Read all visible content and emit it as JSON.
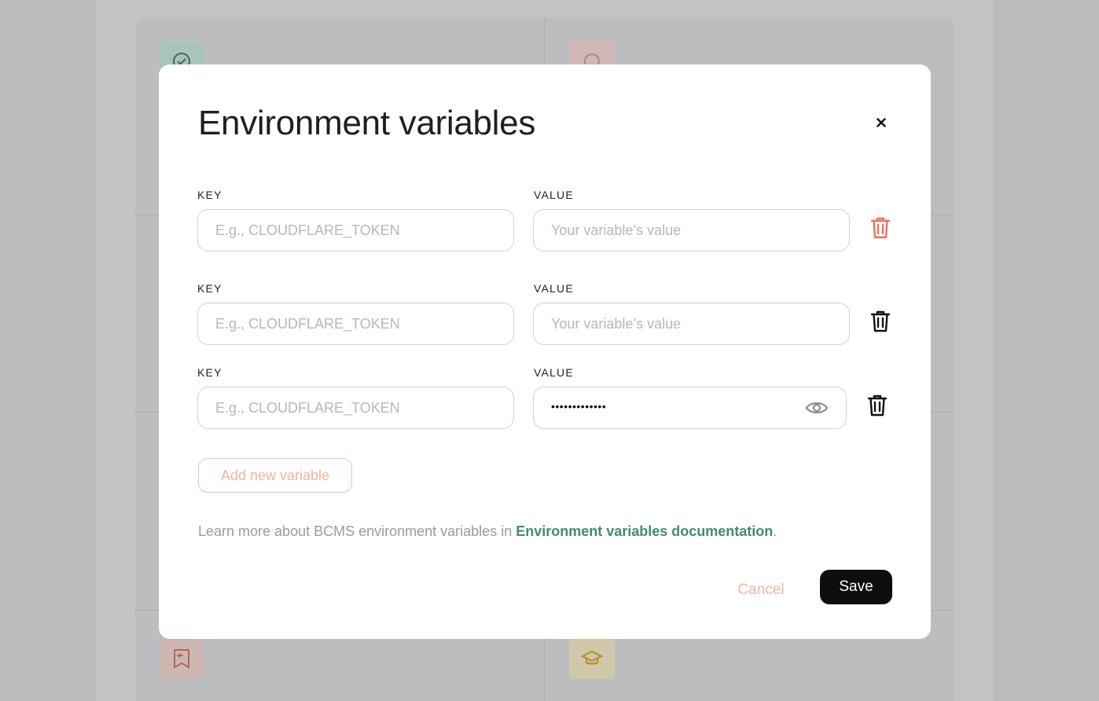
{
  "modal": {
    "title": "Environment variables",
    "rows": [
      {
        "key_label": "KEY",
        "key_value": "",
        "key_placeholder": "E.g., CLOUDFLARE_TOKEN",
        "value_label": "VALUE",
        "value_value": "",
        "value_placeholder": "Your variable’s value",
        "masked": false
      },
      {
        "key_label": "KEY",
        "key_value": "",
        "key_placeholder": "E.g., CLOUDFLARE_TOKEN",
        "value_label": "VALUE",
        "value_value": "",
        "value_placeholder": "Your variable’s value",
        "masked": false
      },
      {
        "key_label": "KEY",
        "key_value": "",
        "key_placeholder": "E.g., CLOUDFLARE_TOKEN",
        "value_label": "VALUE",
        "value_masked_text": "•••••••••••••",
        "masked": true
      }
    ],
    "add_button_label": "Add new variable",
    "learn_more_prefix": "Learn more about BCMS environment variables in ",
    "learn_more_link": "Environment variables documentation",
    "learn_more_suffix": ".",
    "cancel_label": "Cancel",
    "save_label": "Save"
  },
  "icons": {
    "close": "close-icon",
    "trash": "trash-icon",
    "eye": "eye-icon",
    "check_circle": "check-circle-icon",
    "badge": "badge-icon",
    "bookmark_back": "bookmark-back-icon",
    "graduation_cap": "graduation-cap-icon"
  },
  "colors": {
    "accent_green": "#3f8d6e",
    "danger_red": "#e8735a",
    "accent_orange_light": "#f0b3a2",
    "save_bg": "#0e0e10"
  }
}
